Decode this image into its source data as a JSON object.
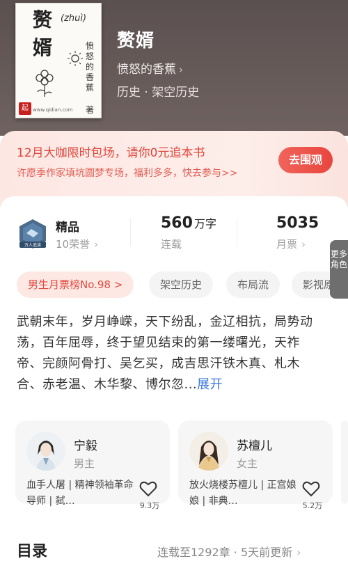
{
  "book": {
    "cover": {
      "title_line1": "赘",
      "title_line2": "婿",
      "pinyin": "(zhuì)",
      "author_vertical": "愤怒的香蕉",
      "author_suffix": "著",
      "seal_text": "起",
      "url": "www.qidian.com"
    },
    "title": "赘婿",
    "author": "愤怒的香蕉",
    "author_chevron": "›",
    "genre": "历史 · 架空历史"
  },
  "promo": {
    "title": "12月大咖限时包场，请你0元追本书",
    "subtitle": "许愿季作家填坑圆梦专场，福利多多，快去参与>>",
    "button": "去围观"
  },
  "stats": {
    "quality": {
      "label": "精品",
      "sub": "10荣誉",
      "badge_text": "万人追读"
    },
    "words": {
      "value": "560",
      "unit": "万字",
      "sub": "连载"
    },
    "tickets": {
      "value": "5035",
      "sub": "月票"
    },
    "chevron": "›"
  },
  "tags": [
    {
      "label": "男生月票榜No.98 >"
    },
    {
      "label": "架空历史"
    },
    {
      "label": "布局流"
    },
    {
      "label": "影视原著"
    }
  ],
  "description": {
    "text": "武朝末年，岁月峥嵘，天下纷乱，金辽相抗，局势动荡，百年屈辱，终于望见结束的第一缕曙光，天祚帝、完颜阿骨打、吴乞买，成吉思汗铁木真、札木合、赤老温、木华黎、博尔忽...",
    "more": "展开"
  },
  "characters": [
    {
      "name": "宁毅",
      "role": "男主",
      "desc": "血手人屠 | 精神领袖革命导师 | 弑…",
      "likes": "9.3万"
    },
    {
      "name": "苏檀儿",
      "role": "女主",
      "desc": "放火烧楼苏檀儿 | 正宫娘娘 | 非典…",
      "likes": "5.2万"
    }
  ],
  "more_roles": "更多角色",
  "toc": {
    "title": "目录",
    "status": "连载至1292章 · 5天前更新",
    "chevron": "›"
  },
  "colors": {
    "accent": "#e8463e",
    "link": "#3d78d6",
    "header_bg": "#5f5453"
  }
}
